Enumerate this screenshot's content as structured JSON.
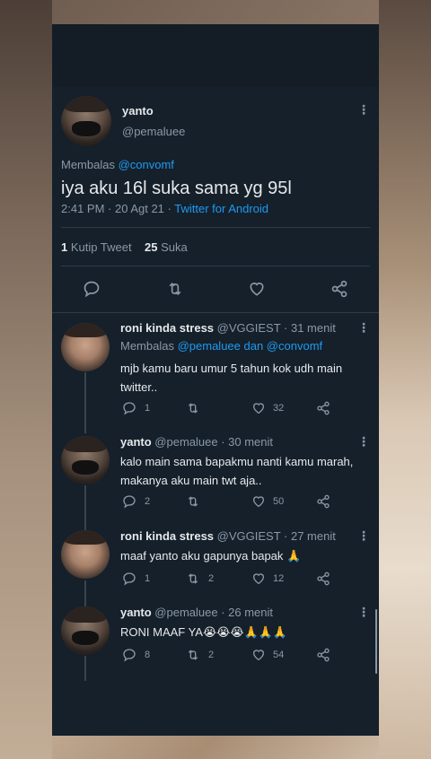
{
  "main_tweet": {
    "name": "yanto",
    "handle": "@pemaluee",
    "reply_prefix": "Membalas",
    "reply_to": "@convomf",
    "text": "iya aku 16l suka sama yg 95l",
    "time": "2:41 PM · 20 Agt 21 ·",
    "source": "Twitter for Android",
    "quote_count": "1",
    "quote_label": "Kutip Tweet",
    "like_count": "25",
    "like_label": "Suka"
  },
  "replies": [
    {
      "name": "roni kinda stress",
      "meta": "@VGGIEST · 31 menit",
      "reply_prefix": "Membalas",
      "reply_to": "@pemaluee dan @convomf",
      "text_line1": "mjb kamu baru umur 5 tahun kok udh main",
      "text_line2": "twitter..",
      "replies": "1",
      "retweets": "",
      "likes": "32"
    },
    {
      "name": "yanto",
      "meta": "@pemaluee · 30 menit",
      "text_line1": "kalo main sama bapakmu nanti kamu marah,",
      "text_line2": "makanya aku main twt aja..",
      "replies": "2",
      "retweets": "",
      "likes": "50"
    },
    {
      "name": "roni kinda stress",
      "meta": "@VGGIEST · 27 menit",
      "text_line1": "maaf yanto aku gapunya bapak 🙏",
      "replies": "1",
      "retweets": "2",
      "likes": "12"
    },
    {
      "name": "yanto",
      "meta": "@pemaluee · 26 menit",
      "text_line1": "RONI MAAF YA😭😭😭🙏🙏🙏",
      "replies": "8",
      "retweets": "2",
      "likes": "54"
    }
  ],
  "icons": {
    "more": "more-vertical-icon",
    "reply": "reply-icon",
    "retweet": "retweet-icon",
    "like": "heart-icon",
    "share": "share-icon"
  },
  "colors": {
    "background": "#15202b",
    "link": "#1d9bf0",
    "muted": "#8b98a5"
  }
}
